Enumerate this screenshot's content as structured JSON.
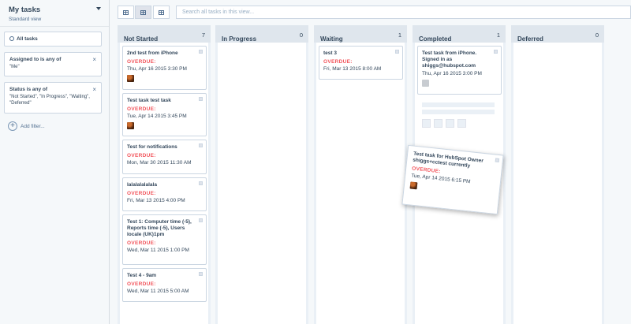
{
  "sidebar": {
    "title": "My tasks",
    "subtitle": "Standard view",
    "filters": [
      {
        "title": "All tasks",
        "value": "",
        "removable": false
      },
      {
        "title": "Assigned to is any of",
        "value": "\"Me\"",
        "removable": true
      },
      {
        "title": "Status is any of",
        "value": "\"Not Started\", \"In Progress\", \"Waiting\", \"Deferred\"",
        "removable": true
      }
    ],
    "add_filter": "Add filter..."
  },
  "search": {
    "placeholder": "Search all tasks in this view..."
  },
  "columns": [
    {
      "title": "Not Started",
      "count": "7"
    },
    {
      "title": "In Progress",
      "count": "0"
    },
    {
      "title": "Waiting",
      "count": "1"
    },
    {
      "title": "Completed",
      "count": "1"
    },
    {
      "title": "Deferred",
      "count": "0"
    }
  ],
  "cards": {
    "not_started": [
      {
        "title": "2nd test from iPhone",
        "overdue": "OVERDUE:",
        "due": "Thu, Apr 16 2015 3:30 PM"
      },
      {
        "title": "Test task test task",
        "overdue": "OVERDUE:",
        "due": "Tue, Apr 14 2015 3:45 PM"
      },
      {
        "title": "Test for notifications",
        "overdue": "OVERDUE:",
        "due": "Mon, Mar 30 2015 11:30 AM"
      },
      {
        "title": "lalalalalalala",
        "overdue": "OVERDUE:",
        "due": "Fri, Mar 13 2015 4:00 PM"
      },
      {
        "title": "Test 1: Computer time (-5), Reports time (-5), Users locale (UK)1pm",
        "overdue": "OVERDUE:",
        "due": "Wed, Mar 11 2015 1:00 PM"
      },
      {
        "title": "Test 4 - 9am",
        "overdue": "OVERDUE:",
        "due": "Wed, Mar 11 2015 5:00 AM"
      }
    ],
    "waiting": [
      {
        "title": "test 3",
        "overdue": "OVERDUE:",
        "due": "Fri, Mar 13 2015 8:00 AM"
      }
    ],
    "completed": [
      {
        "title": "Test task from iPhone. Signed in as shiggs@hubspot.com",
        "due": "Thu, Apr 16 2015 3:00 PM"
      }
    ],
    "dragging": {
      "title": "Test task for HubSpot Owner shiggs+cctest currently",
      "overdue": "OVERDUE:",
      "due": "Tue, Apr 14 2015 6:15 PM"
    }
  },
  "colors": {
    "overdue": "#f2545b",
    "column_bg": "#eaf0f6",
    "text": "#33475b"
  }
}
